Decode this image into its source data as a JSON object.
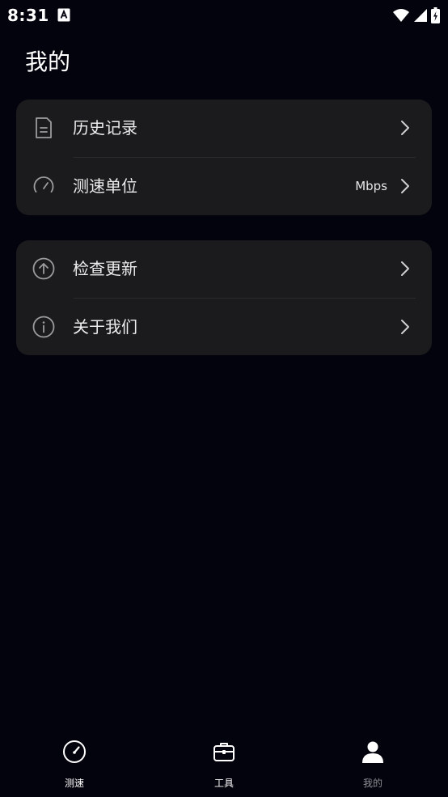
{
  "status_bar": {
    "time": "8:31",
    "notification_icon": "a-notification-icon",
    "wifi_icon": "wifi-icon",
    "signal_icon": "signal-icon",
    "battery_icon": "battery-charging-icon"
  },
  "page": {
    "title": "我的"
  },
  "menu_group_1": {
    "items": [
      {
        "label": "历史记录",
        "icon": "document-icon",
        "value": ""
      },
      {
        "label": "测速单位",
        "icon": "speedometer-icon",
        "value": "Mbps"
      }
    ]
  },
  "menu_group_2": {
    "items": [
      {
        "label": "检查更新",
        "icon": "arrow-up-circle-icon",
        "value": ""
      },
      {
        "label": "关于我们",
        "icon": "info-circle-icon",
        "value": ""
      }
    ]
  },
  "tab_bar": {
    "tabs": [
      {
        "label": "测速",
        "icon": "speedometer-icon",
        "active": false
      },
      {
        "label": "工具",
        "icon": "toolbox-icon",
        "active": false
      },
      {
        "label": "我的",
        "icon": "user-icon",
        "active": true
      }
    ]
  },
  "colors": {
    "background": "#03030d",
    "card": "#1b1b1e",
    "text_primary": "#ffffff",
    "text_inactive_tab": "#8e8e93",
    "divider": "#2b2b2f"
  }
}
